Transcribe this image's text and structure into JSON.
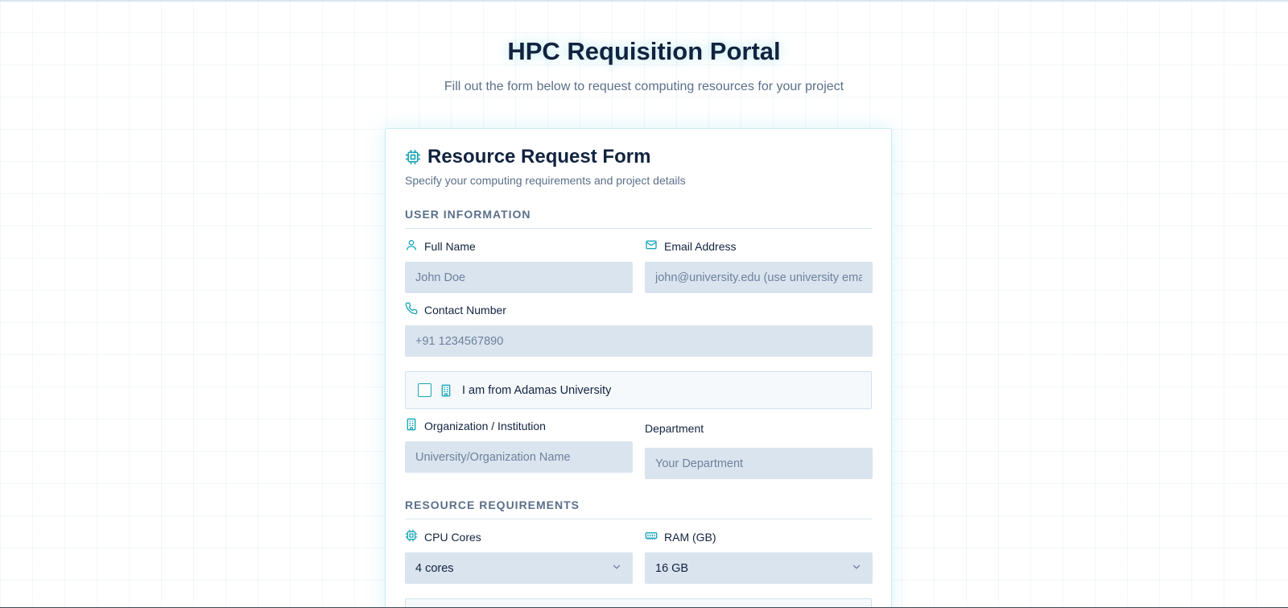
{
  "header": {
    "title": "HPC Requisition Portal",
    "subtitle": "Fill out the form below to request computing resources for your project"
  },
  "form": {
    "title": "Resource Request Form",
    "description": "Specify your computing requirements and project details",
    "user_section": {
      "heading": "USER INFORMATION",
      "full_name": {
        "label": "Full Name",
        "placeholder": "John Doe"
      },
      "email": {
        "label": "Email Address",
        "placeholder": "john@university.edu (use university email)"
      },
      "contact": {
        "label": "Contact Number",
        "placeholder": "+91 1234567890"
      },
      "adamas_checkbox": {
        "label": "I am from Adamas University",
        "checked": false
      },
      "organization": {
        "label": "Organization / Institution",
        "placeholder": "University/Organization Name"
      },
      "department": {
        "label": "Department",
        "placeholder": "Your Department"
      }
    },
    "resource_section": {
      "heading": "RESOURCE REQUIREMENTS",
      "cpu": {
        "label": "CPU Cores",
        "value": "4 cores"
      },
      "ram": {
        "label": "RAM (GB)",
        "value": "16 GB"
      }
    }
  },
  "colors": {
    "accent": "#1aa6b8",
    "input_bg": "#dae4ef",
    "heading": "#12233f",
    "muted": "#5b6f8a"
  },
  "icons": {
    "title": "cpu-icon",
    "full_name": "user-icon",
    "email": "mail-icon",
    "contact": "phone-icon",
    "checkbox": "building-icon",
    "organization": "building-icon",
    "cpu": "cpu-icon",
    "ram": "memory-icon",
    "select": "chevron-down-icon"
  }
}
